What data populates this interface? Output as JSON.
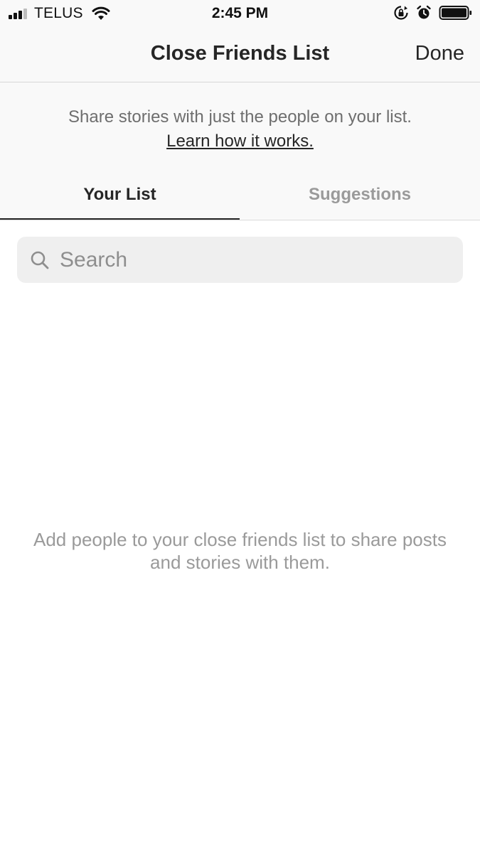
{
  "status_bar": {
    "carrier": "TELUS",
    "time": "2:45 PM",
    "icons": [
      "signal-icon",
      "wifi-icon",
      "orientation-lock-icon",
      "alarm-icon",
      "battery-icon"
    ]
  },
  "header": {
    "title": "Close Friends List",
    "done_label": "Done"
  },
  "info": {
    "text": "Share stories with just the people on your list.",
    "link": "Learn how it works."
  },
  "tabs": [
    {
      "label": "Your List",
      "active": true
    },
    {
      "label": "Suggestions",
      "active": false
    }
  ],
  "search": {
    "placeholder": "Search",
    "value": ""
  },
  "empty_state": {
    "text": "Add people to your close friends list to share posts and stories with them."
  },
  "colors": {
    "header_bg": "#f9f9f9",
    "text_primary": "#262626",
    "text_secondary": "#6e6e6e",
    "text_muted": "#9a9a9a",
    "search_bg": "#efefef",
    "divider": "#d6d6d6"
  }
}
